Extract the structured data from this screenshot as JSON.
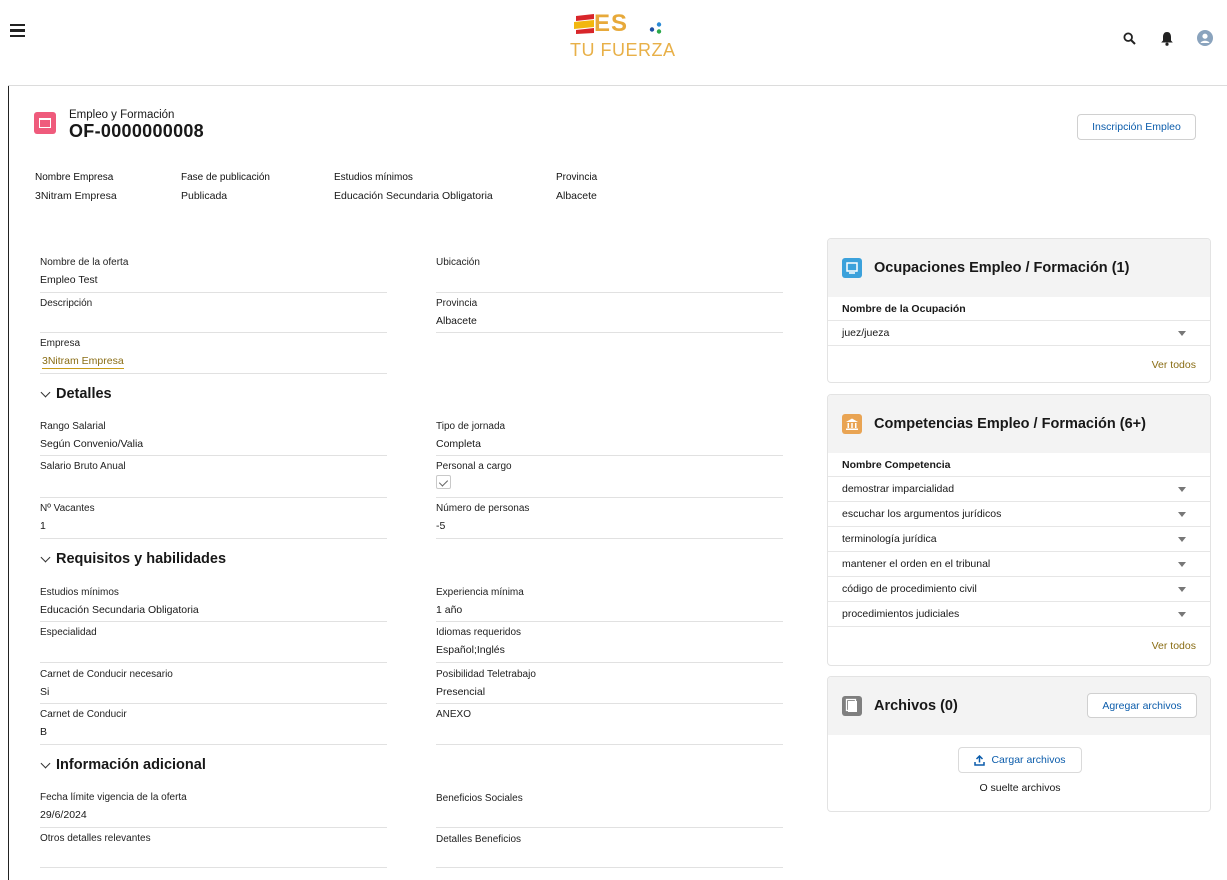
{
  "header": {
    "logo_es": "ES",
    "logo_tagline": "TU FUERZA",
    "icons": [
      "menu-icon",
      "search-icon",
      "bell-icon",
      "user-avatar-icon"
    ]
  },
  "record": {
    "object_label": "Empleo y Formación",
    "record_name": "OF-0000000008",
    "action_button": "Inscripción Empleo",
    "highlights": [
      {
        "label": "Nombre Empresa",
        "value": "3Nitram Empresa"
      },
      {
        "label": "Fase de publicación",
        "value": "Publicada"
      },
      {
        "label": "Estudios mínimos",
        "value": "Educación Secundaria Obligatoria"
      },
      {
        "label": "Provincia",
        "value": "Albacete"
      }
    ]
  },
  "details": {
    "top": {
      "nombre_oferta": {
        "label": "Nombre de la oferta",
        "value": "Empleo Test"
      },
      "ubicacion": {
        "label": "Ubicación",
        "value": ""
      },
      "descripcion": {
        "label": "Descripción",
        "value": ""
      },
      "provincia": {
        "label": "Provincia",
        "value": "Albacete"
      },
      "empresa": {
        "label": "Empresa",
        "value": "3Nitram Empresa"
      }
    },
    "sec_detalles": {
      "title": "Detalles",
      "rango_salarial": {
        "label": "Rango Salarial",
        "value": "Según Convenio/Valia"
      },
      "tipo_jornada": {
        "label": "Tipo de jornada",
        "value": "Completa"
      },
      "salario": {
        "label": "Salario Bruto Anual",
        "value": ""
      },
      "personal_cargo": {
        "label": "Personal a cargo",
        "checked": true
      },
      "vacantes": {
        "label": "Nº Vacantes",
        "value": "1"
      },
      "num_personas": {
        "label": "Número de personas",
        "value": "-5"
      }
    },
    "sec_requisitos": {
      "title": "Requisitos y habilidades",
      "estudios": {
        "label": "Estudios mínimos",
        "value": "Educación Secundaria Obligatoria"
      },
      "experiencia": {
        "label": "Experiencia mínima",
        "value": "1 año"
      },
      "especialidad": {
        "label": "Especialidad",
        "value": ""
      },
      "idiomas": {
        "label": "Idiomas requeridos",
        "value": "Español;Inglés"
      },
      "carnet_nec": {
        "label": "Carnet de Conducir necesario",
        "value": "Si"
      },
      "teletrabajo": {
        "label": "Posibilidad Teletrabajo",
        "value": "Presencial"
      },
      "carnet": {
        "label": "Carnet de Conducir",
        "value": "B"
      },
      "anexo": {
        "label": "ANEXO",
        "value": ""
      }
    },
    "sec_info": {
      "title": "Información adicional",
      "fecha_limite": {
        "label": "Fecha límite vigencia de la oferta",
        "value": "29/6/2024"
      },
      "beneficios": {
        "label": "Beneficios Sociales",
        "value": ""
      },
      "otros": {
        "label": "Otros detalles relevantes",
        "value": ""
      },
      "detalles_beneficios": {
        "label": "Detalles Beneficios",
        "value": ""
      }
    }
  },
  "related": {
    "ocupaciones": {
      "title": "Ocupaciones Empleo / Formación (1)",
      "column": "Nombre de la Ocupación",
      "rows": [
        "juez/jueza"
      ],
      "view_all": "Ver todos",
      "icon_color": "#3ba1db"
    },
    "competencias": {
      "title": "Competencias Empleo / Formación (6+)",
      "column": "Nombre Competencia",
      "rows": [
        "demostrar imparcialidad",
        "escuchar los argumentos jurídicos",
        "terminología jurídica",
        "mantener el orden en el tribunal",
        "código de procedimiento civil",
        "procedimientos judiciales"
      ],
      "view_all": "Ver todos",
      "icon_color": "#e9a453"
    },
    "archivos": {
      "title": "Archivos (0)",
      "add_button": "Agregar archivos",
      "upload_button": "Cargar archivos",
      "drop_text": "O suelte archivos",
      "icon_color": "#7f7f7f"
    }
  },
  "colors": {
    "accent_link": "#8a6d14",
    "brand_blue": "#0b5cab",
    "record_icon": "#ef5b7c"
  }
}
